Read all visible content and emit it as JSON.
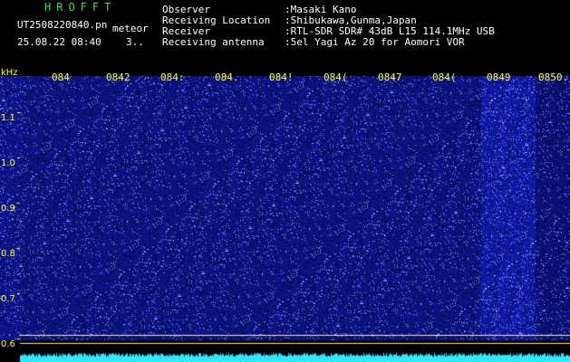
{
  "app": {
    "logo_text": "HROFFT",
    "file_name": "UT2508220840.pn",
    "detection_label": "meteor",
    "timestamp": "25.08.22 08:40",
    "count": "3..",
    "info": [
      {
        "label": "Observer",
        "value": ":Masaki Kano"
      },
      {
        "label": "Receiving Location",
        "value": ":Shibukawa,Gunma,Japan"
      },
      {
        "label": "Receiver",
        "value": ":RTL-SDR SDR# 43dB L15 114.1MHz USB"
      },
      {
        "label": "Receiving antenna",
        "value": ":5el Yagi Az 20 for Aomori VOR"
      }
    ]
  },
  "spectrogram": {
    "freq_unit": "kHz",
    "freq_ticks": [
      "1.1",
      "1.0",
      "0.9",
      "0.8",
      "0.7",
      "0.6"
    ],
    "time_ticks": [
      "084",
      "0842",
      "084:",
      "084.",
      "084!",
      "084(",
      "0847",
      "084(",
      "0849",
      "0850."
    ],
    "colors": {
      "background": "#000000",
      "noise": "#0f1fa8",
      "tick_text": "#ffff3a",
      "trace": "#33e6ff",
      "baseline": "#ffe79a"
    }
  }
}
